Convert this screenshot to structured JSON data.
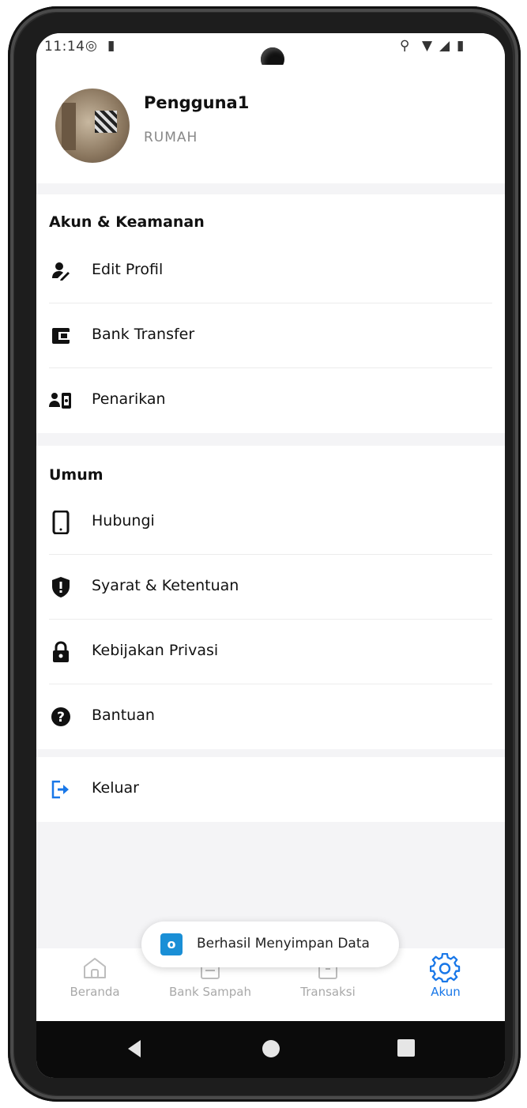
{
  "status_bar": {
    "time": "11:14"
  },
  "profile": {
    "name": "Pengguna1",
    "role": "RUMAH"
  },
  "sections": {
    "account": {
      "title": "Akun & Keamanan",
      "items": [
        {
          "label": "Edit Profil",
          "icon": "user-edit-icon"
        },
        {
          "label": "Bank Transfer",
          "icon": "wallet-icon"
        },
        {
          "label": "Penarikan",
          "icon": "withdrawal-icon"
        }
      ]
    },
    "general": {
      "title": "Umum",
      "items": [
        {
          "label": "Hubungi",
          "icon": "phone-icon"
        },
        {
          "label": "Syarat & Ketentuan",
          "icon": "shield-icon"
        },
        {
          "label": "Kebijakan Privasi",
          "icon": "lock-icon"
        },
        {
          "label": "Bantuan",
          "icon": "help-icon"
        }
      ]
    },
    "logout": {
      "label": "Keluar",
      "icon": "logout-icon",
      "color": "#1877e8"
    }
  },
  "toast": {
    "message": "Berhasil Menyimpan Data"
  },
  "bottom_nav": {
    "items": [
      {
        "label": "Beranda",
        "icon": "home-icon"
      },
      {
        "label": "Bank Sampah",
        "icon": "document-icon"
      },
      {
        "label": "Transaksi",
        "icon": "receipt-icon"
      },
      {
        "label": "Akun",
        "icon": "gear-icon",
        "active": true
      }
    ],
    "active_color": "#1877e8"
  }
}
